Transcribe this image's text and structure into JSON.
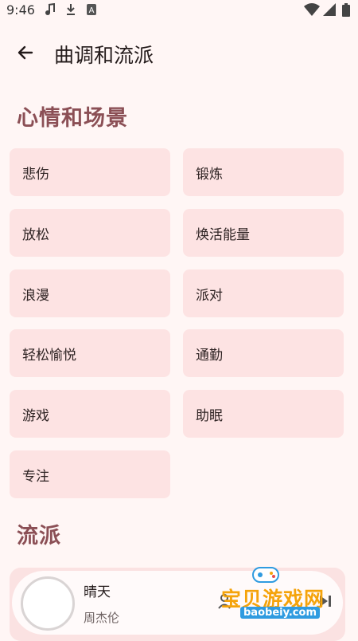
{
  "status_bar": {
    "time": "9:46"
  },
  "header": {
    "title": "曲调和流派"
  },
  "mood_section": {
    "title": "心情和场景",
    "tiles": [
      {
        "label": "悲伤"
      },
      {
        "label": "锻炼"
      },
      {
        "label": "放松"
      },
      {
        "label": "焕活能量"
      },
      {
        "label": "浪漫"
      },
      {
        "label": "派对"
      },
      {
        "label": "轻松愉悦"
      },
      {
        "label": "通勤"
      },
      {
        "label": "游戏"
      },
      {
        "label": "助眠"
      },
      {
        "label": "专注"
      }
    ]
  },
  "genre_section": {
    "title": "流派"
  },
  "player": {
    "song": "晴天",
    "artist": "周杰伦"
  },
  "watermark": {
    "text": "宝贝游戏网",
    "url": "baobeiy.com"
  },
  "colors": {
    "background": "#fff6f5",
    "tile": "#fde3e3",
    "section_title": "#8b4f55",
    "player_bg": "#fbe2e2"
  },
  "icons": [
    "back-arrow-icon",
    "music-note-icon",
    "download-icon",
    "app-a-icon",
    "wifi-icon",
    "signal-icon",
    "battery-icon",
    "playlist-icon",
    "skip-next-icon"
  ]
}
